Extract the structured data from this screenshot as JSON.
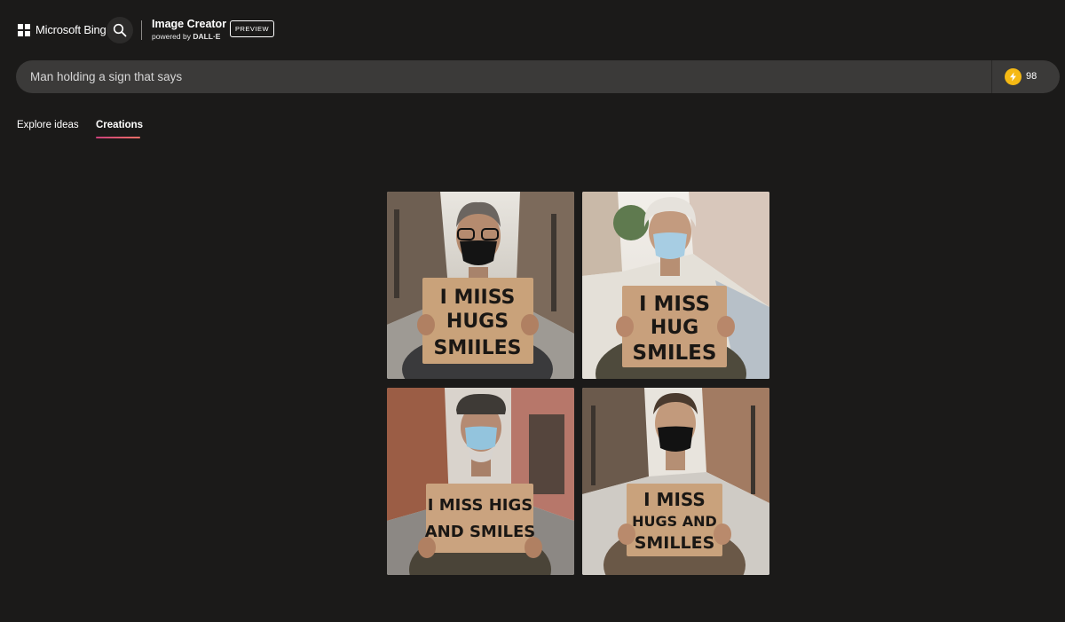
{
  "header": {
    "logo_text": "Microsoft Bing",
    "app_title": "Image Creator",
    "powered_prefix": "powered by ",
    "powered_brand": "DALL·E",
    "preview_label": "PREVIEW",
    "boosts": "98"
  },
  "search": {
    "prompt": "Man holding a sign that says"
  },
  "tabs": [
    {
      "label": "Explore ideas",
      "active": false
    },
    {
      "label": "Creations",
      "active": true
    }
  ],
  "colors": {
    "background": "#1b1a19",
    "searchbar": "#3b3a39",
    "coin": "#f5b914",
    "tab_underline": [
      "#c9407a",
      "#f27066"
    ]
  },
  "images": [
    {
      "sign_lines": [
        "I MIISS",
        "HUGS",
        "SMIILES"
      ]
    },
    {
      "sign_lines": [
        "I MISS",
        "HUG",
        "SMILES"
      ]
    },
    {
      "sign_lines": [
        "I MISS HIGS",
        "AND SMILES"
      ]
    },
    {
      "sign_lines": [
        "I MISS",
        "HUGS AND",
        "SMILLES"
      ]
    }
  ]
}
